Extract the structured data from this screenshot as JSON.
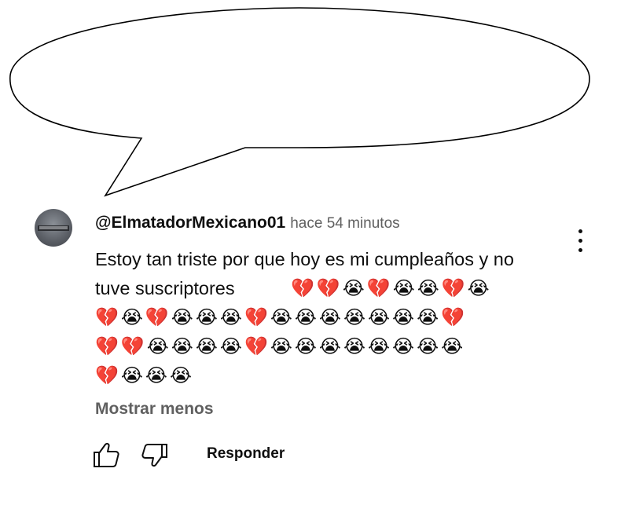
{
  "comment": {
    "author": "@ElmatadorMexicano01",
    "time": "hace 54 minutos",
    "text": "Estoy tan triste por que hoy es mi cumpleaños  y no tuve suscriptores",
    "emoji_line_1": "💔💔😭💔😭😭💔😭",
    "emoji_line_2": "💔😭💔😭😭😭💔😭😭😭😭😭😭😭💔",
    "emoji_line_3": "💔💔😭😭😭😭💔😭😭😭😭😭😭😭😭",
    "emoji_line_4": "💔😭😭😭",
    "show_less_label": "Mostrar menos",
    "reply_label": "Responder"
  },
  "icons": {
    "like": "thumbs-up-icon",
    "dislike": "thumbs-down-icon",
    "menu": "more-vertical-icon"
  }
}
